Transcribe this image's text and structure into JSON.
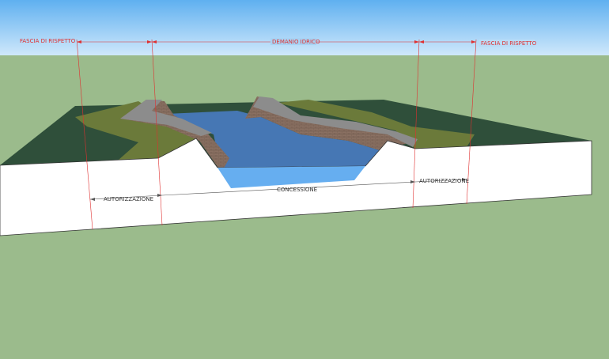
{
  "labels": {
    "fascia_left": "FASCIA DI RISPETTO",
    "demanio": "DEMANIO IDRICO",
    "fascia_right": "FASCIA DI RISPETTO",
    "autorizzazione_left": "AUTORIZZAZIONE",
    "concessione": "CONCESSIONE",
    "autorizzazione_right": "AUTORIZZAZIONE"
  },
  "colors": {
    "sky": "#a7d3f4",
    "ground": "#9bbb8c",
    "terrain": "#2f4f3a",
    "grass_band": "#6b7a3a",
    "embankment": "#7a6a5e",
    "water": "#4677b4",
    "water_section": "#66aef0",
    "section_face": "#ffffff",
    "annotation": "#e03030",
    "dimension": "#555555"
  }
}
